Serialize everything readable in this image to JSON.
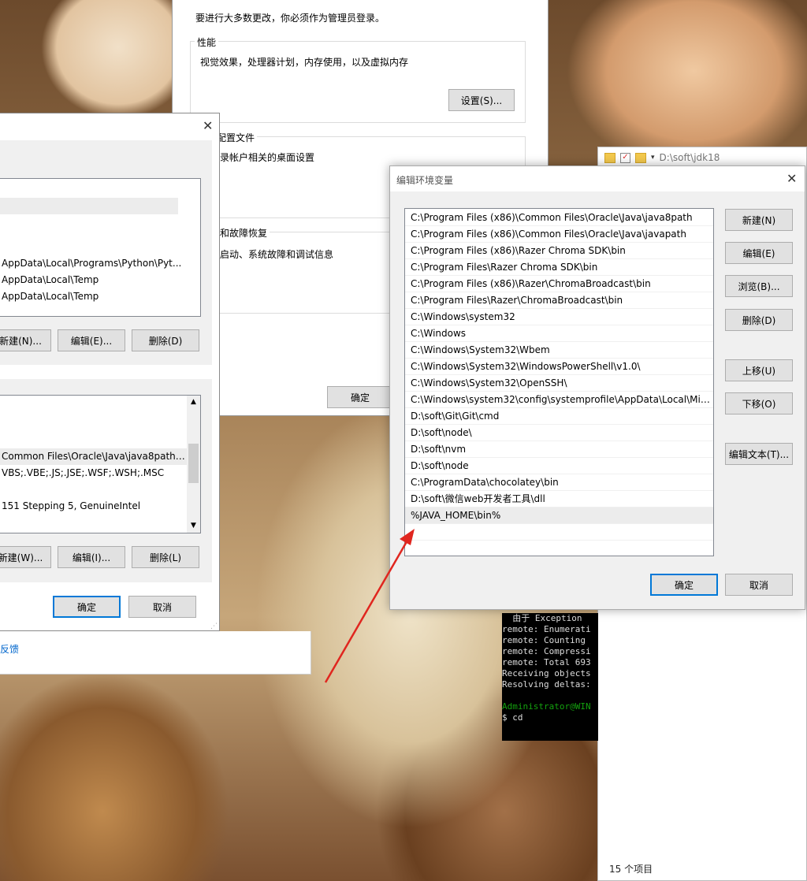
{
  "system_props": {
    "admin_notice": "要进行大多数更改，你必须作为管理员登录。",
    "performance": {
      "title": "性能",
      "desc": "视觉效果，处理器计划，内存使用，以及虚拟内存",
      "settings_button": "设置(S)..."
    },
    "profile": {
      "title_partial": "配置文件",
      "desc_partial": "录帐户相关的桌面设置"
    },
    "startup": {
      "title_partial": "和故障恢复",
      "desc_partial": "启动、系统故障和调试信息"
    },
    "ok_button": "确定"
  },
  "env_vars_dialog": {
    "user_vars": [
      {
        "value": "AppData\\Local\\Programs\\Python\\Pyt..."
      },
      {
        "value": "AppData\\Local\\Temp"
      },
      {
        "value": "AppData\\Local\\Temp"
      }
    ],
    "user_buttons": {
      "new": "新建(N)...",
      "edit": "编辑(E)...",
      "delete": "删除(D)"
    },
    "system_vars": [
      {
        "value": "Common Files\\Oracle\\Java\\java8path;..."
      },
      {
        "value": "VBS;.VBE;.JS;.JSE;.WSF;.WSH;.MSC"
      },
      {
        "value": "151 Stepping 5, GenuineIntel"
      }
    ],
    "system_buttons": {
      "new": "新建(W)...",
      "edit": "编辑(I)...",
      "delete": "删除(L)"
    },
    "ok": "确定",
    "cancel": "取消",
    "feedback_link": "反馈"
  },
  "edit_env_dialog": {
    "title": "编辑环境变量",
    "paths": [
      "C:\\Program Files (x86)\\Common Files\\Oracle\\Java\\java8path",
      "C:\\Program Files (x86)\\Common Files\\Oracle\\Java\\javapath",
      "C:\\Program Files (x86)\\Razer Chroma SDK\\bin",
      "C:\\Program Files\\Razer Chroma SDK\\bin",
      "C:\\Program Files (x86)\\Razer\\ChromaBroadcast\\bin",
      "C:\\Program Files\\Razer\\ChromaBroadcast\\bin",
      "C:\\Windows\\system32",
      "C:\\Windows",
      "C:\\Windows\\System32\\Wbem",
      "C:\\Windows\\System32\\WindowsPowerShell\\v1.0\\",
      "C:\\Windows\\System32\\OpenSSH\\",
      "C:\\Windows\\system32\\config\\systemprofile\\AppData\\Local\\Mic...",
      "D:\\soft\\Git\\Git\\cmd",
      "D:\\soft\\node\\",
      "D:\\soft\\nvm",
      "D:\\soft\\node",
      "C:\\ProgramData\\chocolatey\\bin",
      "D:\\soft\\微信web开发者工具\\dll",
      "%JAVA_HOME\\bin%"
    ],
    "selected_index": 18,
    "buttons": {
      "new": "新建(N)",
      "edit": "编辑(E)",
      "browse": "浏览(B)...",
      "delete": "删除(D)",
      "move_up": "上移(U)",
      "move_down": "下移(O)",
      "edit_text": "编辑文本(T)..."
    },
    "ok": "确定",
    "cancel": "取消"
  },
  "explorer": {
    "path": "D:\\soft\\jdk18",
    "status": "15 个项目"
  },
  "terminal": {
    "lines": [
      "  由于 Exception",
      "remote: Enumerati",
      "remote: Counting",
      "remote: Compressi",
      "remote: Total 693",
      "Receiving objects",
      "Resolving deltas:",
      "",
      "Administrator@WIN",
      "$ cd "
    ],
    "prompt_color": "#13a10e"
  },
  "arrow_color": "#e0261f"
}
